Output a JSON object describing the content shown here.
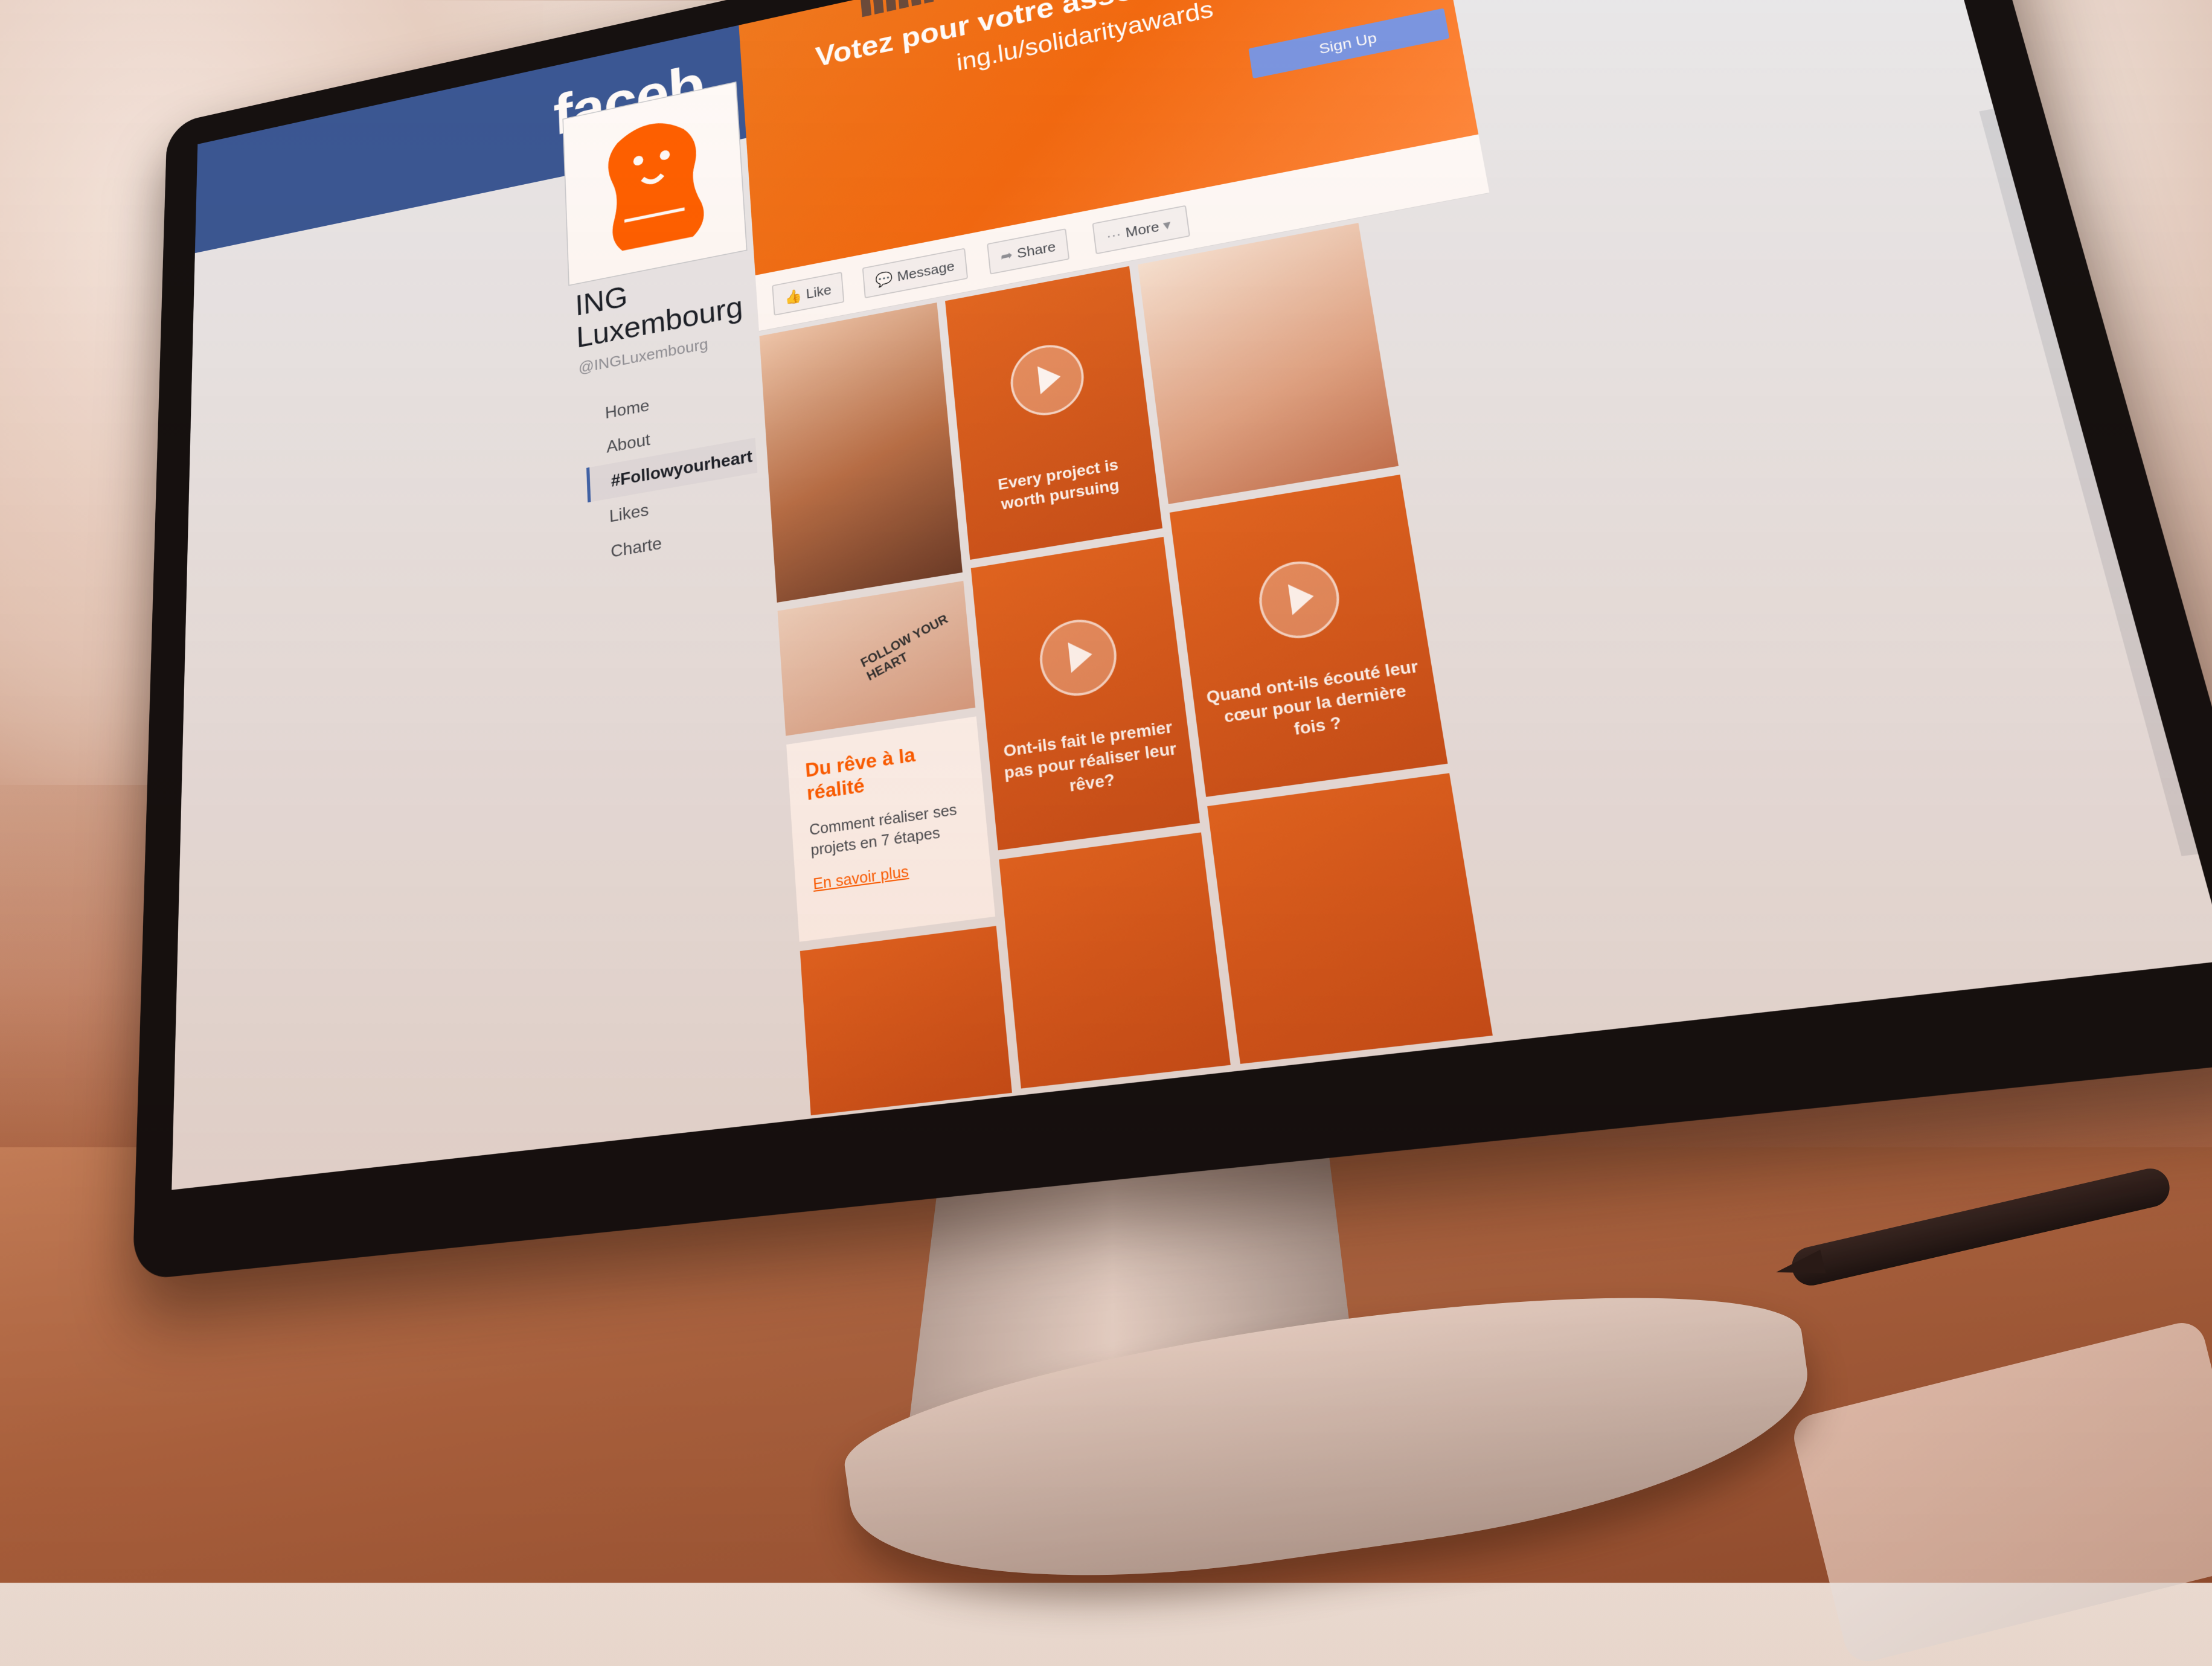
{
  "header": {
    "logo_text": "faceb"
  },
  "page": {
    "name": "ING Luxembourg",
    "handle": "@INGLuxembourg"
  },
  "nav": [
    {
      "label": "Home",
      "active": false
    },
    {
      "label": "About",
      "active": false
    },
    {
      "label": "#Followyourheart",
      "active": true
    },
    {
      "label": "Likes",
      "active": false
    },
    {
      "label": "Charte",
      "active": false
    }
  ],
  "cover": {
    "title": "Votez pour votre association préféré",
    "url": "ing.lu/solidarityawards",
    "cta": "Sign Up"
  },
  "actions": {
    "like": "Like",
    "message": "Message",
    "share": "Share",
    "more": "More"
  },
  "videos": [
    {
      "caption": "Every project is worth pursuing"
    },
    {
      "caption": "Quand ont-ils écouté leur cœur pour la dernière fois ?"
    },
    {
      "caption": "Ont-ils fait le premier pas pour réaliser leur rêve?"
    }
  ],
  "photo_texts": {
    "hand_text": "FOLLOW YOUR HEART"
  },
  "article": {
    "title": "Du rêve à la réalité",
    "description": "Comment réaliser ses projets en 7 étapes",
    "link": "En savoir plus"
  },
  "colors": {
    "facebook_blue": "#3b5998",
    "ing_orange": "#ff6200",
    "signup_blue": "#7b98e6"
  }
}
